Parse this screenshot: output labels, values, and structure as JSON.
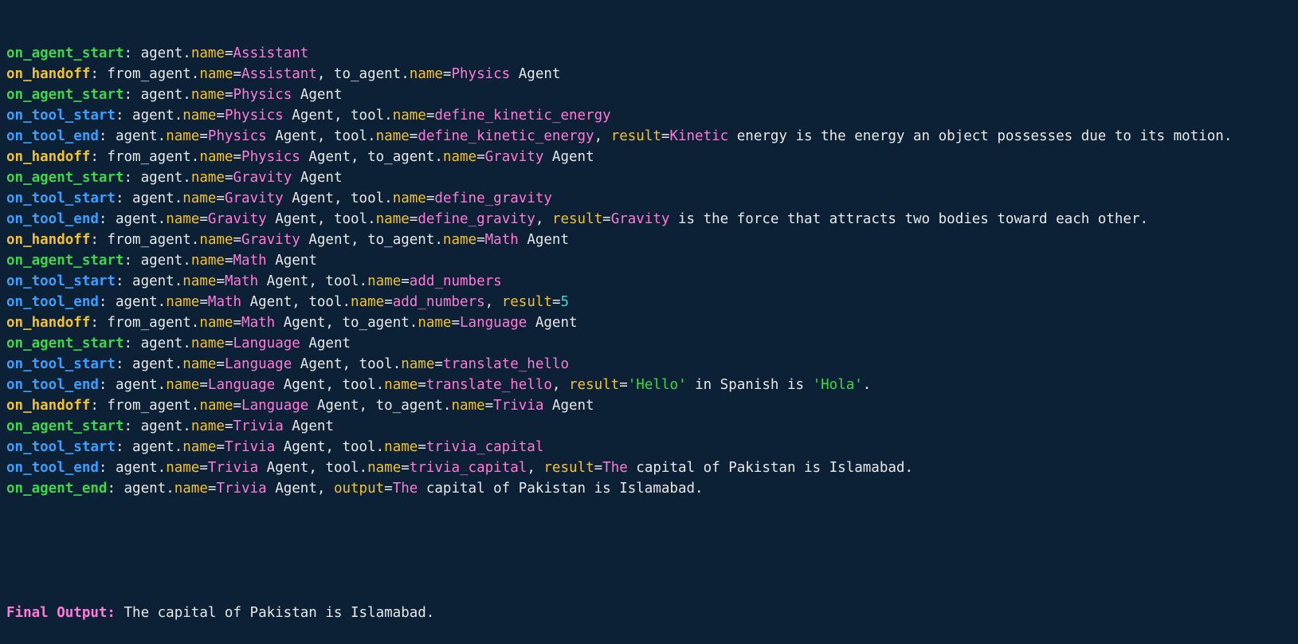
{
  "window": {
    "theme_colors": {
      "background": "#0c2136",
      "text": "#e8e8e8",
      "green": "#3ed64a",
      "yellow": "#f2c230",
      "blue": "#3aa0ff",
      "magenta": "#ff7ad9",
      "cyan": "#35d6d6"
    }
  },
  "log_lines": [
    {
      "color": "green",
      "segments": [
        {
          "c": "ev-green",
          "t": "on_agent_start"
        },
        {
          "c": "plain",
          "t": ": agent."
        },
        {
          "c": "key",
          "t": "name"
        },
        {
          "c": "plain",
          "t": "="
        },
        {
          "c": "val",
          "t": "Assistant"
        }
      ]
    },
    {
      "color": "yellow",
      "segments": [
        {
          "c": "ev-yellow",
          "t": "on_handoff"
        },
        {
          "c": "plain",
          "t": ": from_agent."
        },
        {
          "c": "key",
          "t": "name"
        },
        {
          "c": "plain",
          "t": "="
        },
        {
          "c": "val",
          "t": "Assistant"
        },
        {
          "c": "plain",
          "t": ", to_agent."
        },
        {
          "c": "key",
          "t": "name"
        },
        {
          "c": "plain",
          "t": "="
        },
        {
          "c": "val",
          "t": "Physics"
        },
        {
          "c": "plain",
          "t": " Agent"
        }
      ]
    },
    {
      "color": "green",
      "segments": [
        {
          "c": "ev-green",
          "t": "on_agent_start"
        },
        {
          "c": "plain",
          "t": ": agent."
        },
        {
          "c": "key",
          "t": "name"
        },
        {
          "c": "plain",
          "t": "="
        },
        {
          "c": "val",
          "t": "Physics"
        },
        {
          "c": "plain",
          "t": " Agent"
        }
      ]
    },
    {
      "color": "blue",
      "segments": [
        {
          "c": "ev-blue",
          "t": "on_tool_start"
        },
        {
          "c": "plain",
          "t": ": agent."
        },
        {
          "c": "key",
          "t": "name"
        },
        {
          "c": "plain",
          "t": "="
        },
        {
          "c": "val",
          "t": "Physics"
        },
        {
          "c": "plain",
          "t": " Agent, tool."
        },
        {
          "c": "key",
          "t": "name"
        },
        {
          "c": "plain",
          "t": "="
        },
        {
          "c": "val",
          "t": "define_kinetic_energy"
        }
      ]
    },
    {
      "color": "blue",
      "segments": [
        {
          "c": "ev-blue",
          "t": "on_tool_end"
        },
        {
          "c": "plain",
          "t": ": agent."
        },
        {
          "c": "key",
          "t": "name"
        },
        {
          "c": "plain",
          "t": "="
        },
        {
          "c": "val",
          "t": "Physics"
        },
        {
          "c": "plain",
          "t": " Agent, tool."
        },
        {
          "c": "key",
          "t": "name"
        },
        {
          "c": "plain",
          "t": "="
        },
        {
          "c": "val",
          "t": "define_kinetic_energy"
        },
        {
          "c": "plain",
          "t": ", "
        },
        {
          "c": "key",
          "t": "result"
        },
        {
          "c": "plain",
          "t": "="
        },
        {
          "c": "val",
          "t": "Kinetic"
        },
        {
          "c": "plain",
          "t": " energy is the energy an object possesses due to its motion."
        }
      ]
    },
    {
      "color": "yellow",
      "segments": [
        {
          "c": "ev-yellow",
          "t": "on_handoff"
        },
        {
          "c": "plain",
          "t": ": from_agent."
        },
        {
          "c": "key",
          "t": "name"
        },
        {
          "c": "plain",
          "t": "="
        },
        {
          "c": "val",
          "t": "Physics"
        },
        {
          "c": "plain",
          "t": " Agent, to_agent."
        },
        {
          "c": "key",
          "t": "name"
        },
        {
          "c": "plain",
          "t": "="
        },
        {
          "c": "val",
          "t": "Gravity"
        },
        {
          "c": "plain",
          "t": " Agent"
        }
      ]
    },
    {
      "color": "green",
      "segments": [
        {
          "c": "ev-green",
          "t": "on_agent_start"
        },
        {
          "c": "plain",
          "t": ": agent."
        },
        {
          "c": "key",
          "t": "name"
        },
        {
          "c": "plain",
          "t": "="
        },
        {
          "c": "val",
          "t": "Gravity"
        },
        {
          "c": "plain",
          "t": " Agent"
        }
      ]
    },
    {
      "color": "blue",
      "segments": [
        {
          "c": "ev-blue",
          "t": "on_tool_start"
        },
        {
          "c": "plain",
          "t": ": agent."
        },
        {
          "c": "key",
          "t": "name"
        },
        {
          "c": "plain",
          "t": "="
        },
        {
          "c": "val",
          "t": "Gravity"
        },
        {
          "c": "plain",
          "t": " Agent, tool."
        },
        {
          "c": "key",
          "t": "name"
        },
        {
          "c": "plain",
          "t": "="
        },
        {
          "c": "val",
          "t": "define_gravity"
        }
      ]
    },
    {
      "color": "blue",
      "segments": [
        {
          "c": "ev-blue",
          "t": "on_tool_end"
        },
        {
          "c": "plain",
          "t": ": agent."
        },
        {
          "c": "key",
          "t": "name"
        },
        {
          "c": "plain",
          "t": "="
        },
        {
          "c": "val",
          "t": "Gravity"
        },
        {
          "c": "plain",
          "t": " Agent, tool."
        },
        {
          "c": "key",
          "t": "name"
        },
        {
          "c": "plain",
          "t": "="
        },
        {
          "c": "val",
          "t": "define_gravity"
        },
        {
          "c": "plain",
          "t": ", "
        },
        {
          "c": "key",
          "t": "result"
        },
        {
          "c": "plain",
          "t": "="
        },
        {
          "c": "val",
          "t": "Gravity"
        },
        {
          "c": "plain",
          "t": " is the force that attracts two bodies toward each other."
        }
      ]
    },
    {
      "color": "yellow",
      "segments": [
        {
          "c": "ev-yellow",
          "t": "on_handoff"
        },
        {
          "c": "plain",
          "t": ": from_agent."
        },
        {
          "c": "key",
          "t": "name"
        },
        {
          "c": "plain",
          "t": "="
        },
        {
          "c": "val",
          "t": "Gravity"
        },
        {
          "c": "plain",
          "t": " Agent, to_agent."
        },
        {
          "c": "key",
          "t": "name"
        },
        {
          "c": "plain",
          "t": "="
        },
        {
          "c": "val",
          "t": "Math"
        },
        {
          "c": "plain",
          "t": " Agent"
        }
      ]
    },
    {
      "color": "green",
      "segments": [
        {
          "c": "ev-green",
          "t": "on_agent_start"
        },
        {
          "c": "plain",
          "t": ": agent."
        },
        {
          "c": "key",
          "t": "name"
        },
        {
          "c": "plain",
          "t": "="
        },
        {
          "c": "val",
          "t": "Math"
        },
        {
          "c": "plain",
          "t": " Agent"
        }
      ]
    },
    {
      "color": "blue",
      "segments": [
        {
          "c": "ev-blue",
          "t": "on_tool_start"
        },
        {
          "c": "plain",
          "t": ": agent."
        },
        {
          "c": "key",
          "t": "name"
        },
        {
          "c": "plain",
          "t": "="
        },
        {
          "c": "val",
          "t": "Math"
        },
        {
          "c": "plain",
          "t": " Agent, tool."
        },
        {
          "c": "key",
          "t": "name"
        },
        {
          "c": "plain",
          "t": "="
        },
        {
          "c": "val",
          "t": "add_numbers"
        }
      ]
    },
    {
      "color": "blue",
      "segments": [
        {
          "c": "ev-blue",
          "t": "on_tool_end"
        },
        {
          "c": "plain",
          "t": ": agent."
        },
        {
          "c": "key",
          "t": "name"
        },
        {
          "c": "plain",
          "t": "="
        },
        {
          "c": "val",
          "t": "Math"
        },
        {
          "c": "plain",
          "t": " Agent, tool."
        },
        {
          "c": "key",
          "t": "name"
        },
        {
          "c": "plain",
          "t": "="
        },
        {
          "c": "val",
          "t": "add_numbers"
        },
        {
          "c": "plain",
          "t": ", "
        },
        {
          "c": "key",
          "t": "result"
        },
        {
          "c": "plain",
          "t": "="
        },
        {
          "c": "num",
          "t": "5"
        }
      ]
    },
    {
      "color": "yellow",
      "segments": [
        {
          "c": "ev-yellow",
          "t": "on_handoff"
        },
        {
          "c": "plain",
          "t": ": from_agent."
        },
        {
          "c": "key",
          "t": "name"
        },
        {
          "c": "plain",
          "t": "="
        },
        {
          "c": "val",
          "t": "Math"
        },
        {
          "c": "plain",
          "t": " Agent, to_agent."
        },
        {
          "c": "key",
          "t": "name"
        },
        {
          "c": "plain",
          "t": "="
        },
        {
          "c": "val",
          "t": "Language"
        },
        {
          "c": "plain",
          "t": " Agent"
        }
      ]
    },
    {
      "color": "green",
      "segments": [
        {
          "c": "ev-green",
          "t": "on_agent_start"
        },
        {
          "c": "plain",
          "t": ": agent."
        },
        {
          "c": "key",
          "t": "name"
        },
        {
          "c": "plain",
          "t": "="
        },
        {
          "c": "val",
          "t": "Language"
        },
        {
          "c": "plain",
          "t": " Agent"
        }
      ]
    },
    {
      "color": "blue",
      "segments": [
        {
          "c": "ev-blue",
          "t": "on_tool_start"
        },
        {
          "c": "plain",
          "t": ": agent."
        },
        {
          "c": "key",
          "t": "name"
        },
        {
          "c": "plain",
          "t": "="
        },
        {
          "c": "val",
          "t": "Language"
        },
        {
          "c": "plain",
          "t": " Agent, tool."
        },
        {
          "c": "key",
          "t": "name"
        },
        {
          "c": "plain",
          "t": "="
        },
        {
          "c": "val",
          "t": "translate_hello"
        }
      ]
    },
    {
      "color": "blue",
      "segments": [
        {
          "c": "ev-blue",
          "t": "on_tool_end"
        },
        {
          "c": "plain",
          "t": ": agent."
        },
        {
          "c": "key",
          "t": "name"
        },
        {
          "c": "plain",
          "t": "="
        },
        {
          "c": "val",
          "t": "Language"
        },
        {
          "c": "plain",
          "t": " Agent, tool."
        },
        {
          "c": "key",
          "t": "name"
        },
        {
          "c": "plain",
          "t": "="
        },
        {
          "c": "val",
          "t": "translate_hello"
        },
        {
          "c": "plain",
          "t": ", "
        },
        {
          "c": "key",
          "t": "result"
        },
        {
          "c": "plain",
          "t": "="
        },
        {
          "c": "strq",
          "t": "'Hello'"
        },
        {
          "c": "plain",
          "t": " in Spanish is "
        },
        {
          "c": "strq",
          "t": "'Hola'"
        },
        {
          "c": "plain",
          "t": "."
        }
      ]
    },
    {
      "color": "yellow",
      "segments": [
        {
          "c": "ev-yellow",
          "t": "on_handoff"
        },
        {
          "c": "plain",
          "t": ": from_agent."
        },
        {
          "c": "key",
          "t": "name"
        },
        {
          "c": "plain",
          "t": "="
        },
        {
          "c": "val",
          "t": "Language"
        },
        {
          "c": "plain",
          "t": " Agent, to_agent."
        },
        {
          "c": "key",
          "t": "name"
        },
        {
          "c": "plain",
          "t": "="
        },
        {
          "c": "val",
          "t": "Trivia"
        },
        {
          "c": "plain",
          "t": " Agent"
        }
      ]
    },
    {
      "color": "green",
      "segments": [
        {
          "c": "ev-green",
          "t": "on_agent_start"
        },
        {
          "c": "plain",
          "t": ": agent."
        },
        {
          "c": "key",
          "t": "name"
        },
        {
          "c": "plain",
          "t": "="
        },
        {
          "c": "val",
          "t": "Trivia"
        },
        {
          "c": "plain",
          "t": " Agent"
        }
      ]
    },
    {
      "color": "blue",
      "segments": [
        {
          "c": "ev-blue",
          "t": "on_tool_start"
        },
        {
          "c": "plain",
          "t": ": agent."
        },
        {
          "c": "key",
          "t": "name"
        },
        {
          "c": "plain",
          "t": "="
        },
        {
          "c": "val",
          "t": "Trivia"
        },
        {
          "c": "plain",
          "t": " Agent, tool."
        },
        {
          "c": "key",
          "t": "name"
        },
        {
          "c": "plain",
          "t": "="
        },
        {
          "c": "val",
          "t": "trivia_capital"
        }
      ]
    },
    {
      "color": "blue",
      "segments": [
        {
          "c": "ev-blue",
          "t": "on_tool_end"
        },
        {
          "c": "plain",
          "t": ": agent."
        },
        {
          "c": "key",
          "t": "name"
        },
        {
          "c": "plain",
          "t": "="
        },
        {
          "c": "val",
          "t": "Trivia"
        },
        {
          "c": "plain",
          "t": " Agent, tool."
        },
        {
          "c": "key",
          "t": "name"
        },
        {
          "c": "plain",
          "t": "="
        },
        {
          "c": "val",
          "t": "trivia_capital"
        },
        {
          "c": "plain",
          "t": ", "
        },
        {
          "c": "key",
          "t": "result"
        },
        {
          "c": "plain",
          "t": "="
        },
        {
          "c": "val",
          "t": "The"
        },
        {
          "c": "plain",
          "t": " capital of Pakistan is Islamabad."
        }
      ]
    },
    {
      "color": "green",
      "segments": [
        {
          "c": "ev-green",
          "t": "on_agent_end"
        },
        {
          "c": "plain",
          "t": ": agent."
        },
        {
          "c": "key",
          "t": "name"
        },
        {
          "c": "plain",
          "t": "="
        },
        {
          "c": "val",
          "t": "Trivia"
        },
        {
          "c": "plain",
          "t": " Agent, "
        },
        {
          "c": "key",
          "t": "output"
        },
        {
          "c": "plain",
          "t": "="
        },
        {
          "c": "val",
          "t": "The"
        },
        {
          "c": "plain",
          "t": " capital of Pakistan is Islamabad."
        }
      ]
    }
  ],
  "final_output": {
    "label": "Final Output:",
    "text": " The capital of Pakistan is Islamabad."
  }
}
